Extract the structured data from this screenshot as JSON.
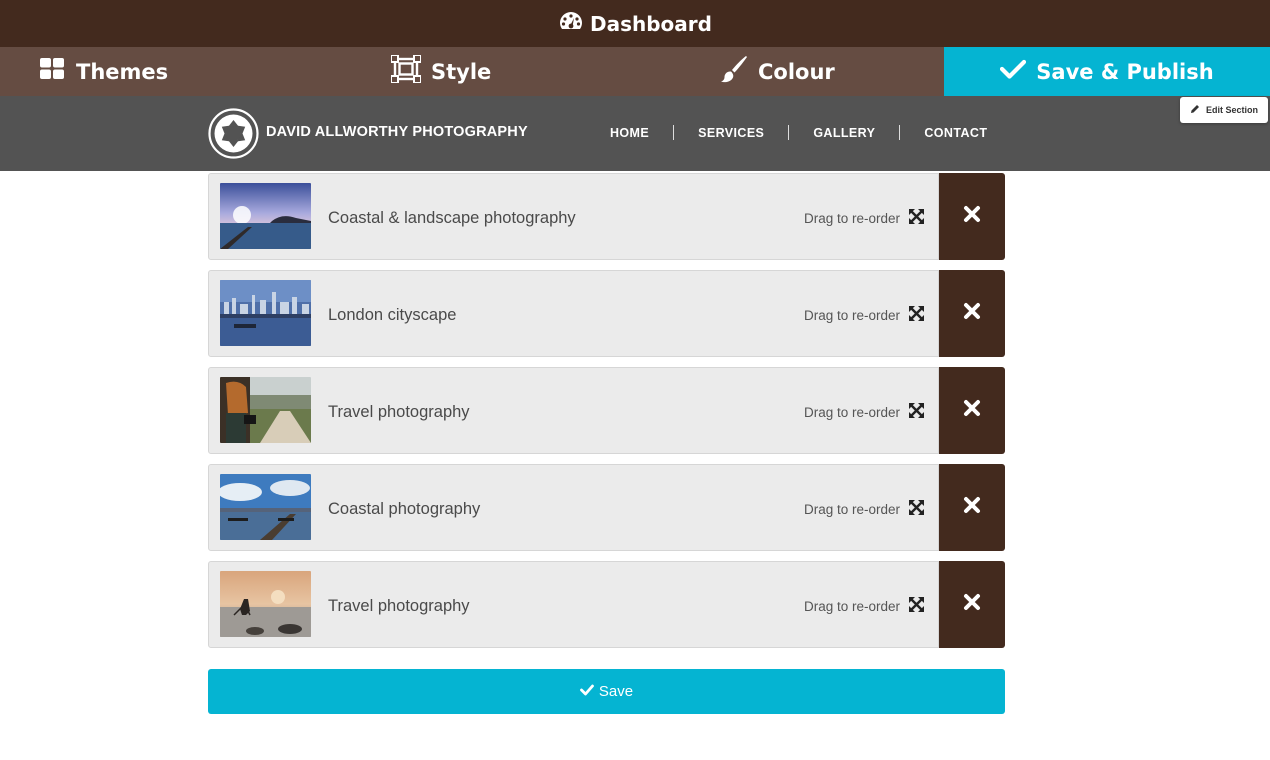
{
  "dashboard": {
    "title": "Dashboard",
    "icon": "speedometer-icon"
  },
  "toolbar": {
    "themes": {
      "label": "Themes",
      "icon": "grid-icon"
    },
    "style": {
      "label": "Style",
      "icon": "crop-frame-icon"
    },
    "colour": {
      "label": "Colour",
      "icon": "paintbrush-icon"
    },
    "publish": {
      "label": "Save & Publish",
      "icon": "checkmark-icon"
    }
  },
  "site": {
    "brand": "DAVID ALLWORTHY PHOTOGRAPHY",
    "logo_icon": "aperture-icon",
    "nav": [
      "HOME",
      "SERVICES",
      "GALLERY",
      "CONTACT"
    ]
  },
  "edit_section": {
    "label": "Edit Section",
    "icon": "pencil-icon"
  },
  "gallery": {
    "drag_label": "Drag to re-order",
    "items": [
      {
        "label": "Coastal & landscape photography",
        "thumb": "lake-sunrise"
      },
      {
        "label": "London cityscape",
        "thumb": "city-skyline"
      },
      {
        "label": "Travel photography",
        "thumb": "hiker-camera"
      },
      {
        "label": "Coastal photography",
        "thumb": "pier-boats"
      },
      {
        "label": "Travel photography",
        "thumb": "sunset-photographer"
      }
    ]
  },
  "save_button": {
    "label": "Save"
  },
  "colors": {
    "dark_brown": "#432a1e",
    "mid_brown": "#654c42",
    "accent": "#05b4d2",
    "header_grey": "#535353",
    "card": "#ebebeb"
  }
}
